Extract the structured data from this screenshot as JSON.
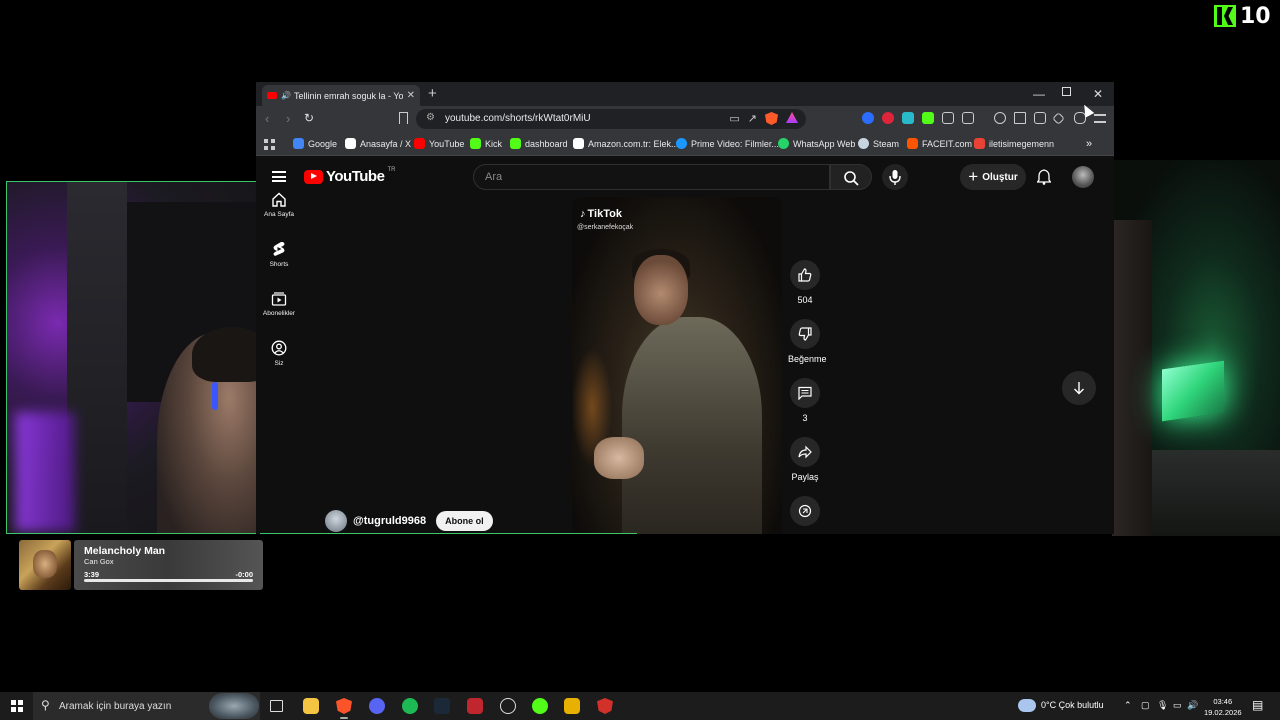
{
  "overlay": {
    "kick_viewers": "10"
  },
  "browser": {
    "tab_title": "Tellinin emrah soguk la - YouTube",
    "url": "youtube.com/shorts/rkWtat0rMiU",
    "bookmarks": [
      {
        "label": "Google",
        "color": "#4285f4"
      },
      {
        "label": "Anasayfa / X",
        "color": "#ffffff"
      },
      {
        "label": "YouTube",
        "color": "#ff0000"
      },
      {
        "label": "Kick",
        "color": "#53fc18"
      },
      {
        "label": "dashboard",
        "color": "#53fc18"
      },
      {
        "label": "Amazon.com.tr: Elek...",
        "color": "#ffffff"
      },
      {
        "label": "Prime Video: Filmler...",
        "color": "#1a98ff"
      },
      {
        "label": "WhatsApp Web",
        "color": "#25d366"
      },
      {
        "label": "Steam",
        "color": "#c7d5e0"
      },
      {
        "label": "FACEIT.com",
        "color": "#ff5500"
      },
      {
        "label": "iletisimegemenn",
        "color": "#ea4335"
      }
    ]
  },
  "youtube": {
    "logo_text": "YouTube",
    "region": "TR",
    "search_placeholder": "Ara",
    "create_label": "Oluştur",
    "sidebar": [
      {
        "label": "Ana Sayfa",
        "icon": "home-icon"
      },
      {
        "label": "Shorts",
        "icon": "shorts-icon"
      },
      {
        "label": "Abonelikler",
        "icon": "subscriptions-icon"
      },
      {
        "label": "Siz",
        "icon": "you-icon"
      }
    ],
    "short": {
      "watermark": "TikTok",
      "watermark_handle": "@serkanefekoçak",
      "channel": "@tugruld9968",
      "subscribe_label": "Abone ol",
      "likes": "504",
      "dislike_label": "Beğenme",
      "comments": "3",
      "share_label": "Paylaş"
    }
  },
  "now_playing": {
    "title": "Melancholy Man",
    "artist": "Can Gox",
    "elapsed": "3:39",
    "remaining": "-0:00"
  },
  "taskbar": {
    "search_placeholder": "Aramak için buraya yazın",
    "weather": "0°C  Çok bulutlu",
    "time": "03:46",
    "date": "19.02.2026"
  }
}
